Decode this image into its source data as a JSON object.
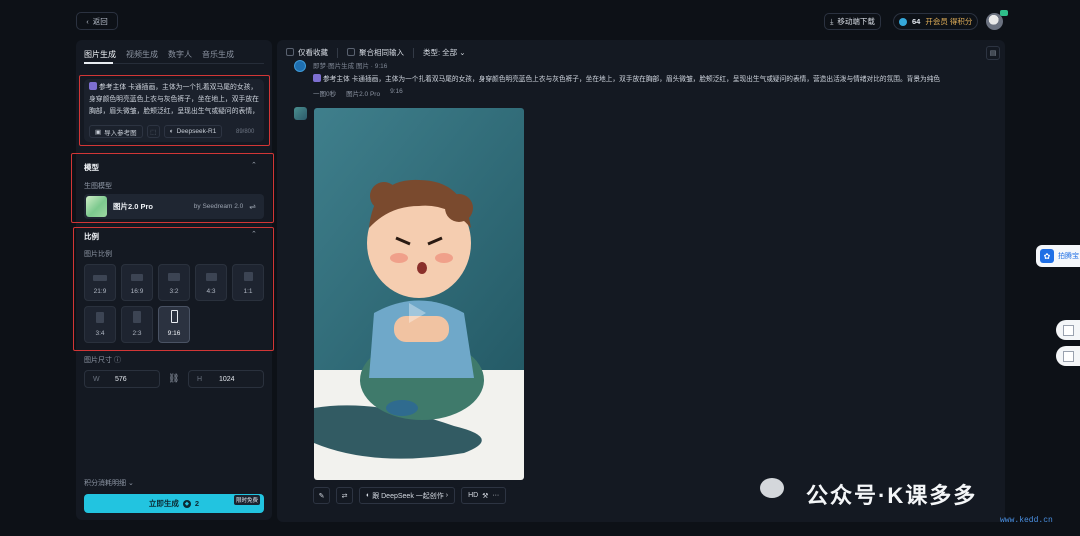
{
  "topbar": {
    "back_label": "返回",
    "download_label": "移动端下载",
    "credits_value": "64",
    "vip_label": "开会员 得积分"
  },
  "left_panel": {
    "tabs": [
      {
        "label": "图片生成",
        "active": true
      },
      {
        "label": "视频生成",
        "active": false
      },
      {
        "label": "数字人",
        "active": false
      },
      {
        "label": "音乐生成",
        "active": false
      }
    ],
    "prompt": {
      "ref_chip": "参考主体",
      "text": "卡通插画，主体为一个扎着双马尾的女孩，身穿颜色明亮蓝色上衣与灰色裤子，坐在地上，双手放在胸部，眉头微皱，脸颊泛红，呈现出生气或疑问的表情，营造出活泼与情绪对比的氛",
      "import_ref_label": "导入参考图",
      "deepseek_label": "Deepseek-R1",
      "counter": "89/800"
    },
    "model_section": {
      "title": "模型",
      "sub_label": "生图模型",
      "model_name": "图片2.0 Pro",
      "model_by": "by Seedream 2.0"
    },
    "ratio_section": {
      "title": "比例",
      "sub_label": "图片比例",
      "ratios": [
        "21:9",
        "16:9",
        "3:2",
        "4:3",
        "1:1",
        "3:4",
        "2:3",
        "9:16"
      ],
      "selected": "9:16"
    },
    "size_section": {
      "label": "图片尺寸",
      "w_key": "W",
      "w_value": "576",
      "h_key": "H",
      "h_value": "1024"
    },
    "cost_detail_label": "积分消耗明细",
    "generate_label": "立即生成",
    "generate_cost": "2",
    "limited_badge": "限时免费"
  },
  "right_panel": {
    "filters": {
      "collect_only": "仅看收藏",
      "aggregate_input": "聚合相同输入",
      "type_label": "类型: 全部"
    },
    "sender_line": "即梦·图片生成  图片 · 9:16",
    "message": {
      "ref_chip": "参考主体",
      "text": "卡通插画，主体为一个扎着双马尾的女孩，身穿颜色明亮蓝色上衣与灰色裤子，坐在地上，双手放在胸部，眉头微皱，脸颊泛红，呈现出生气或疑问的表情，营造出活泼与情绪对比的氛围。背景为纯色",
      "meta": [
        "一图0秒",
        "图片2.0 Pro",
        "9:16"
      ]
    },
    "toolbar": {
      "deepseek_label": "跟 DeepSeek 一起创作",
      "hd_label": "HD"
    }
  },
  "side_widgets": {
    "tab_label": "拍腾宝"
  },
  "watermark": {
    "text": "公众号·K课多多",
    "url": "www.kedd.cn"
  }
}
